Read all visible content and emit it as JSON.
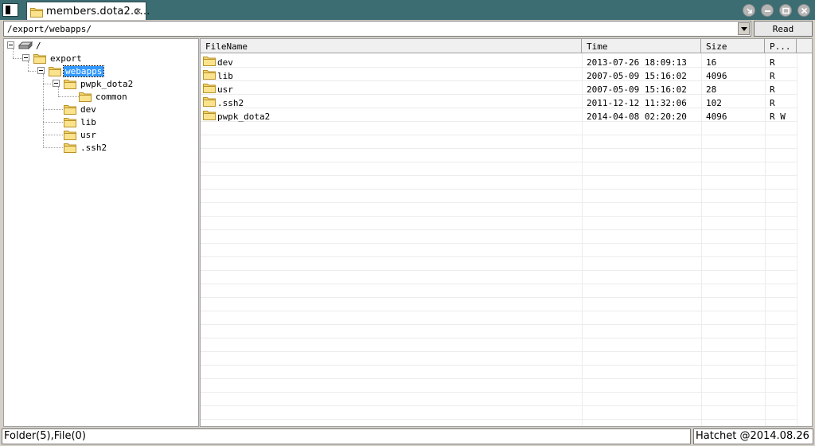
{
  "window": {
    "tab_title": "members.dota2.c...",
    "tab_close": "✕"
  },
  "address": {
    "path": "/export/webapps/",
    "read_label": "Read"
  },
  "tree": {
    "nodes": [
      {
        "label": "/",
        "icon": "drive-icon",
        "expanded": true
      },
      {
        "label": "export",
        "icon": "folder-icon",
        "expanded": true
      },
      {
        "label": "webapps",
        "icon": "folder-icon",
        "expanded": true,
        "selected": true
      },
      {
        "label": "pwpk_dota2",
        "icon": "folder-icon",
        "expanded": true
      },
      {
        "label": "common",
        "icon": "folder-icon"
      },
      {
        "label": "dev",
        "icon": "folder-icon"
      },
      {
        "label": "lib",
        "icon": "folder-icon"
      },
      {
        "label": "usr",
        "icon": "folder-icon"
      },
      {
        "label": ".ssh2",
        "icon": "folder-icon"
      }
    ]
  },
  "list": {
    "columns": [
      "FileName",
      "Time",
      "Size",
      "P..."
    ],
    "rows": [
      {
        "name": "dev",
        "time": "2013-07-26 18:09:13",
        "size": "16",
        "perm": "R"
      },
      {
        "name": "lib",
        "time": "2007-05-09 15:16:02",
        "size": "4096",
        "perm": "R"
      },
      {
        "name": "usr",
        "time": "2007-05-09 15:16:02",
        "size": "28",
        "perm": "R"
      },
      {
        "name": ".ssh2",
        "time": "2011-12-12 11:32:06",
        "size": "102",
        "perm": "R"
      },
      {
        "name": "pwpk_dota2",
        "time": "2014-04-08 02:20:20",
        "size": "4096",
        "perm": "R W"
      }
    ]
  },
  "status": {
    "left": "Folder(5),File(0)",
    "right": "Hatchet @2014.08.26"
  },
  "colors": {
    "titlebar": "#3b6d72",
    "folder": "#f3d36a",
    "selection": "#3399ff"
  }
}
